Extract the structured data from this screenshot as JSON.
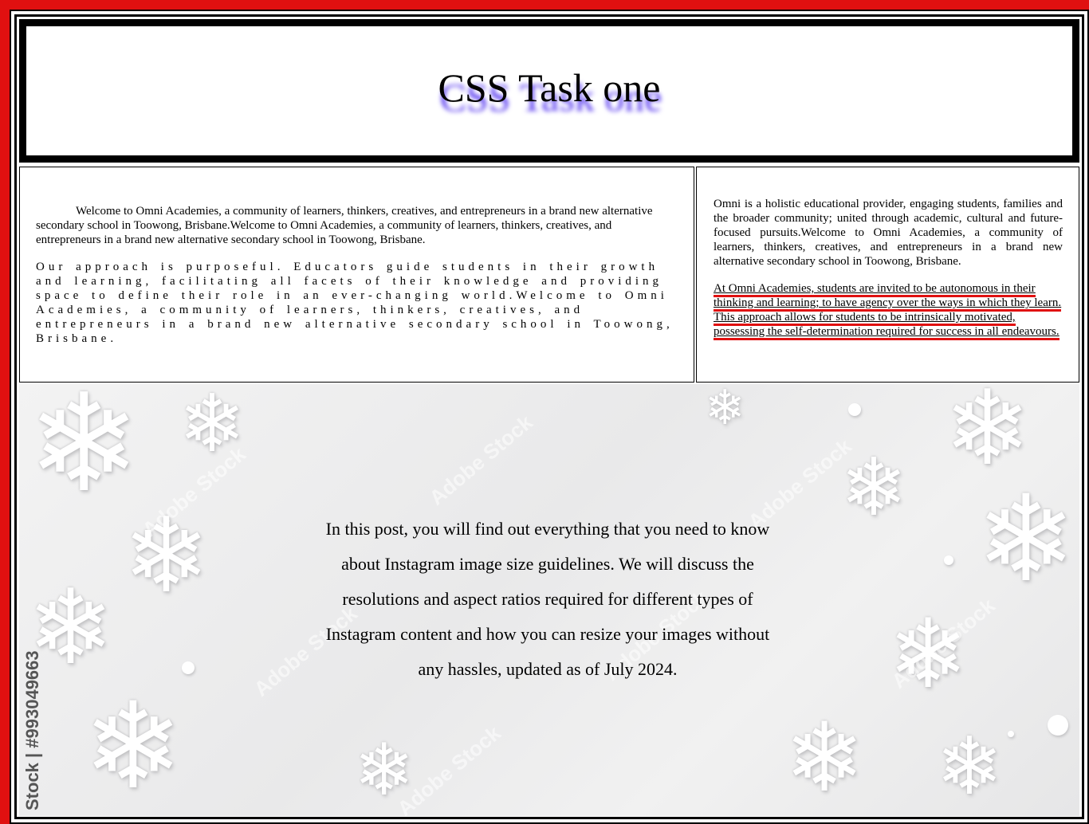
{
  "header": {
    "title": "CSS Task one"
  },
  "left_section": {
    "intro": "Welcome to Omni Academies, a community of learners, thinkers, creatives, and entrepreneurs in a brand new alternative secondary school in Toowong, Brisbane.Welcome to Omni Academies, a community of learners, thinkers, creatives, and entrepreneurs in a brand new alternative secondary school in Toowong, Brisbane.",
    "approach": "Our approach is purposeful. Educators guide students in their growth and learning, facilitating all facets of their knowledge and providing space to define their role in an ever-changing world.Welcome to Omni Academies, a community of learners, thinkers, creatives, and entrepreneurs in a brand new alternative secondary school in Toowong, Brisbane."
  },
  "right_section": {
    "about": "Omni is a holistic educational provider, engaging students, families and the broader community; united through academic, cultural and future-focused pursuits.Welcome to Omni Academies, a community of learners, thinkers, creatives, and entrepreneurs in a brand new alternative secondary school in Toowong, Brisbane.",
    "agency": "At Omni Academies, students are invited to be autonomous in their thinking and learning; to have agency over the ways in which they learn. This approach allows for students to be intrinsically motivated, possessing the self-determination required for success in all endeavours."
  },
  "banner": {
    "text": "In this post, you will find out everything that you need to know about Instagram image size guidelines. We will discuss the resolutions and aspect ratios required for different types of Instagram content and how you can resize your images without any hassles, updated as of July 2024.",
    "watermark": "Adobe Stock",
    "stock_id": "Stock | #993049663"
  },
  "colors": {
    "outer_border": "#e01010",
    "title_shadow": "#5a3cf0",
    "underline_accent": "#e01010"
  }
}
